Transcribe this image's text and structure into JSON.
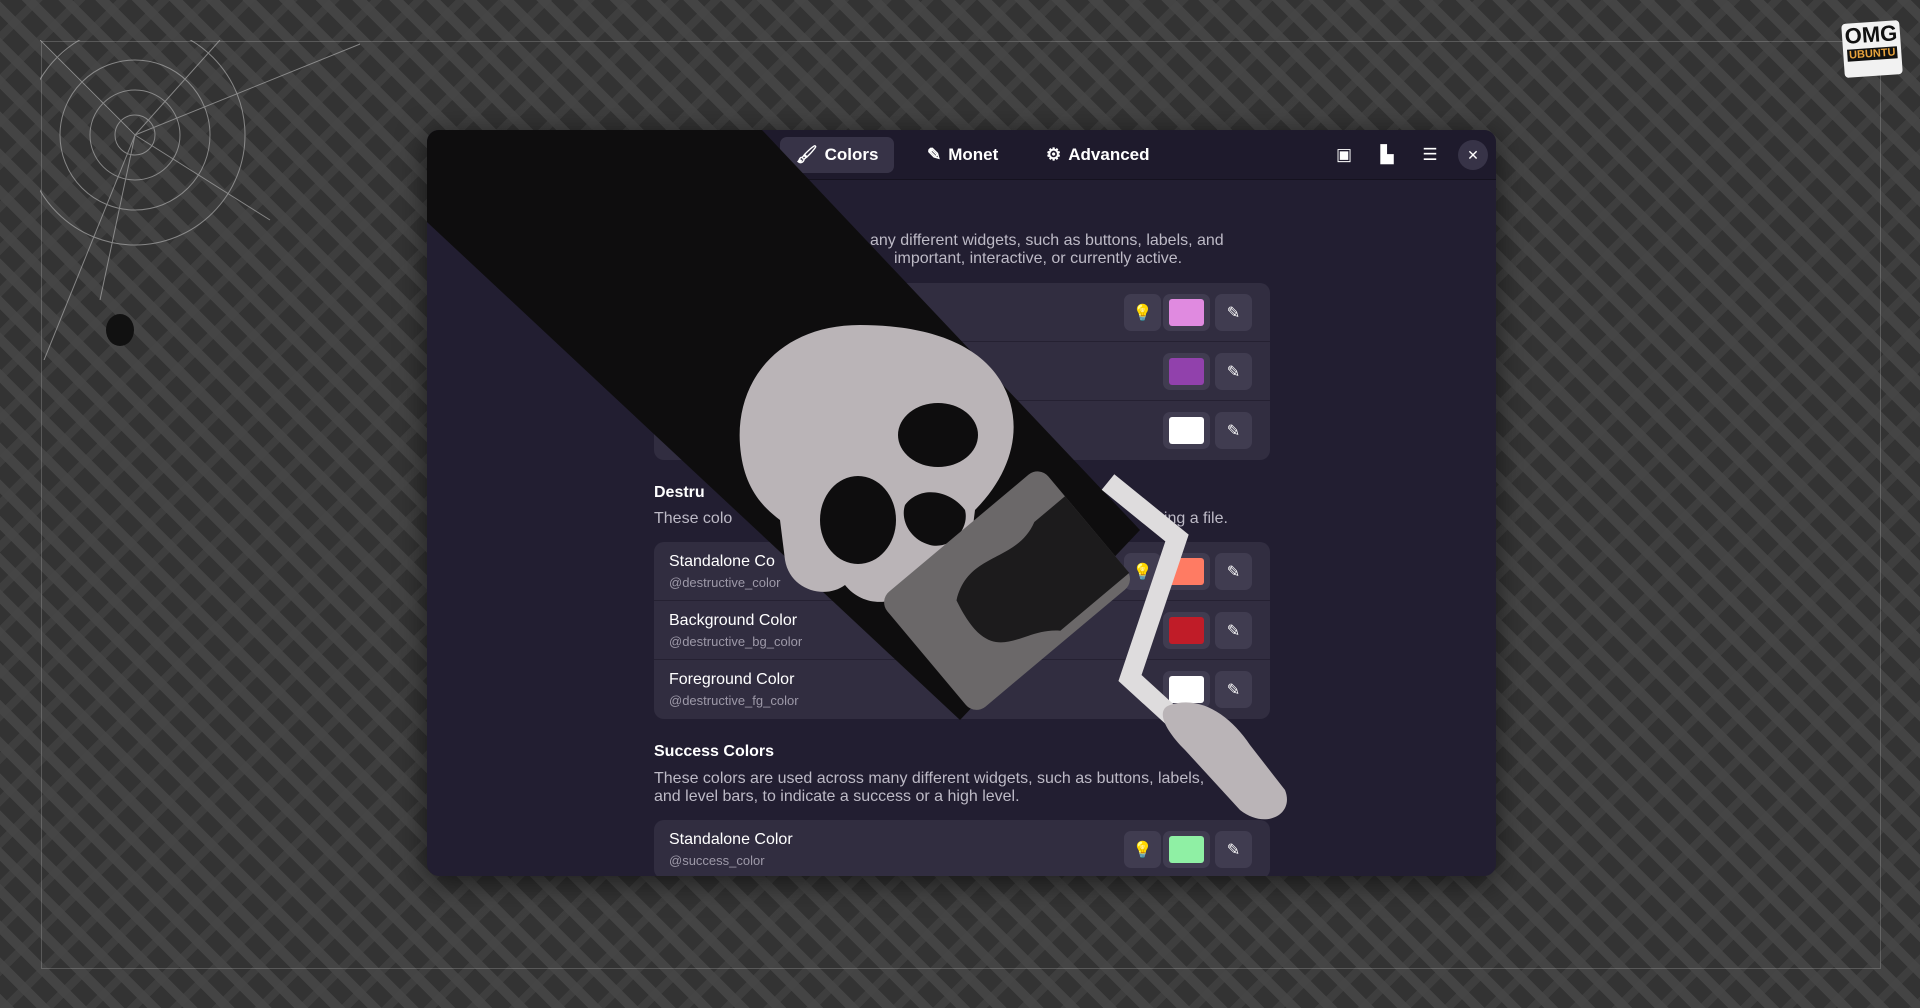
{
  "header": {
    "tabs": [
      {
        "label": "Colors",
        "icon": "brush-icon",
        "active": true
      },
      {
        "label": "Monet",
        "icon": "eyedropper-icon"
      },
      {
        "label": "Advanced",
        "icon": "gear-icon"
      }
    ],
    "buttons": [
      "screenshot-icon",
      "palette-edit-icon",
      "menu-icon",
      "close-icon"
    ]
  },
  "accent": {
    "desc1": "any different widgets, such as buttons, labels, and",
    "desc2": "important, interactive, or currently active.",
    "rows": [
      {
        "color": "#e08ae0",
        "has_bulb": true
      },
      {
        "color": "#9141ac"
      },
      {
        "color": "#ffffff"
      }
    ]
  },
  "destructive": {
    "title": "Destru",
    "desc_a": "These colo",
    "desc_b": "leting a file.",
    "rows": [
      {
        "title": "Standalone Co",
        "sub": "@destructive_color",
        "color": "#ff7b63"
      },
      {
        "title": "Background Color",
        "sub": "@destructive_bg_color",
        "color": "#c01c28"
      },
      {
        "title": "Foreground Color",
        "sub": "@destructive_fg_color",
        "color": "#ffffff"
      }
    ]
  },
  "success": {
    "title": "Success Colors",
    "desc1": "These colors are used across many different widgets, such as buttons, labels,",
    "desc2": "and level bars, to indicate a success or a high level.",
    "rows": [
      {
        "title": "Standalone Color",
        "sub": "@success_color",
        "color": "#8ff0a4"
      }
    ]
  },
  "logo": {
    "line1": "OMG",
    "line2": "UBUNTU"
  }
}
